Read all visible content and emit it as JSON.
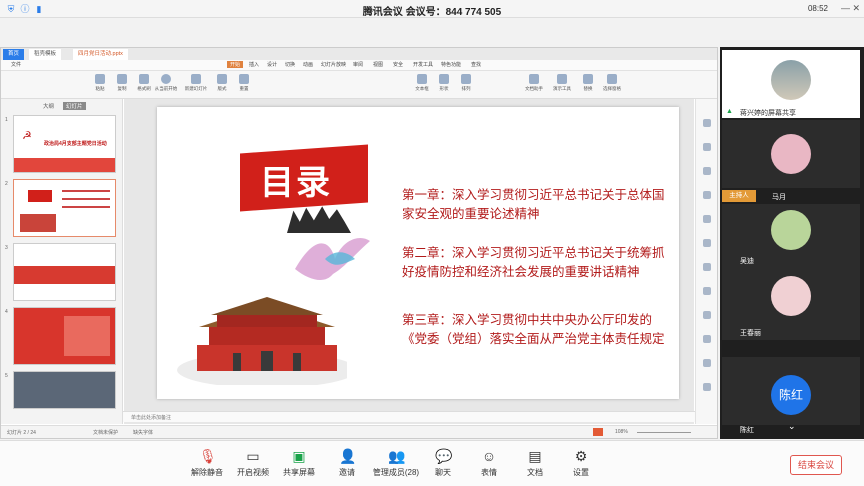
{
  "titlebar": {
    "title": "腾讯会议 会议号：844 774 505",
    "clock": "08:52"
  },
  "wps": {
    "tabs": [
      "首页",
      "稻壳模板",
      "四月党日活动.pptx"
    ],
    "menu": [
      "文件",
      "开始",
      "插入",
      "设计",
      "切换",
      "动画",
      "幻灯片放映",
      "审阅",
      "视图",
      "安全",
      "开发工具",
      "特色功能",
      "查找"
    ],
    "ribbon": [
      "粘贴",
      "复制",
      "格式刷",
      "从当前开始",
      "新建幻灯片",
      "版式",
      "重置",
      "文本框",
      "形状",
      "排列",
      "文档助手",
      "演示工具",
      "替换",
      "选择窗格"
    ],
    "panel_tabs": [
      "大纲",
      "幻灯片"
    ],
    "thumbs": [
      "1",
      "2",
      "3",
      "4",
      "5"
    ],
    "thumb1_title": "政治局4月支部主题党日活动",
    "notes": "单击此处添加备注",
    "status_left": "幻灯片 2 / 24",
    "status_mid": "文档未保护",
    "status_font": "缺失字体",
    "zoom": "108%"
  },
  "slide": {
    "heading": "目录",
    "chapter1": "第一章：深入学习贯彻习近平总书记关于总体国家安全观的重要论述精神",
    "chapter2": "第二章：深入学习贯彻习近平总书记关于统筹抓好疫情防控和经济社会发展的重要讲话精神",
    "chapter3": "第三章：深入学习贯彻中共中央办公厅印发的《党委（党组）落实全面从严治党主体责任规定"
  },
  "participants": [
    {
      "name": "蒋兴婷的屏幕共享",
      "host": false
    },
    {
      "name": "马月",
      "host": true,
      "host_label": "主持人"
    },
    {
      "name": "吴迪",
      "host": false
    },
    {
      "name": "王春丽",
      "host": false
    },
    {
      "name": "陈红",
      "host": false,
      "initials": "陈红"
    }
  ],
  "toolbar": {
    "mute": "解除静音",
    "video": "开启视频",
    "share": "共享屏幕",
    "invite": "邀请",
    "members": "管理成员(28)",
    "chat": "聊天",
    "emoji": "表情",
    "doc": "文档",
    "settings": "设置",
    "end": "结束会议"
  },
  "colors": {
    "flag": "#d1201a",
    "chapter_text": "#b21b1b",
    "accent": "#2b7de9",
    "end": "#d9453e"
  }
}
